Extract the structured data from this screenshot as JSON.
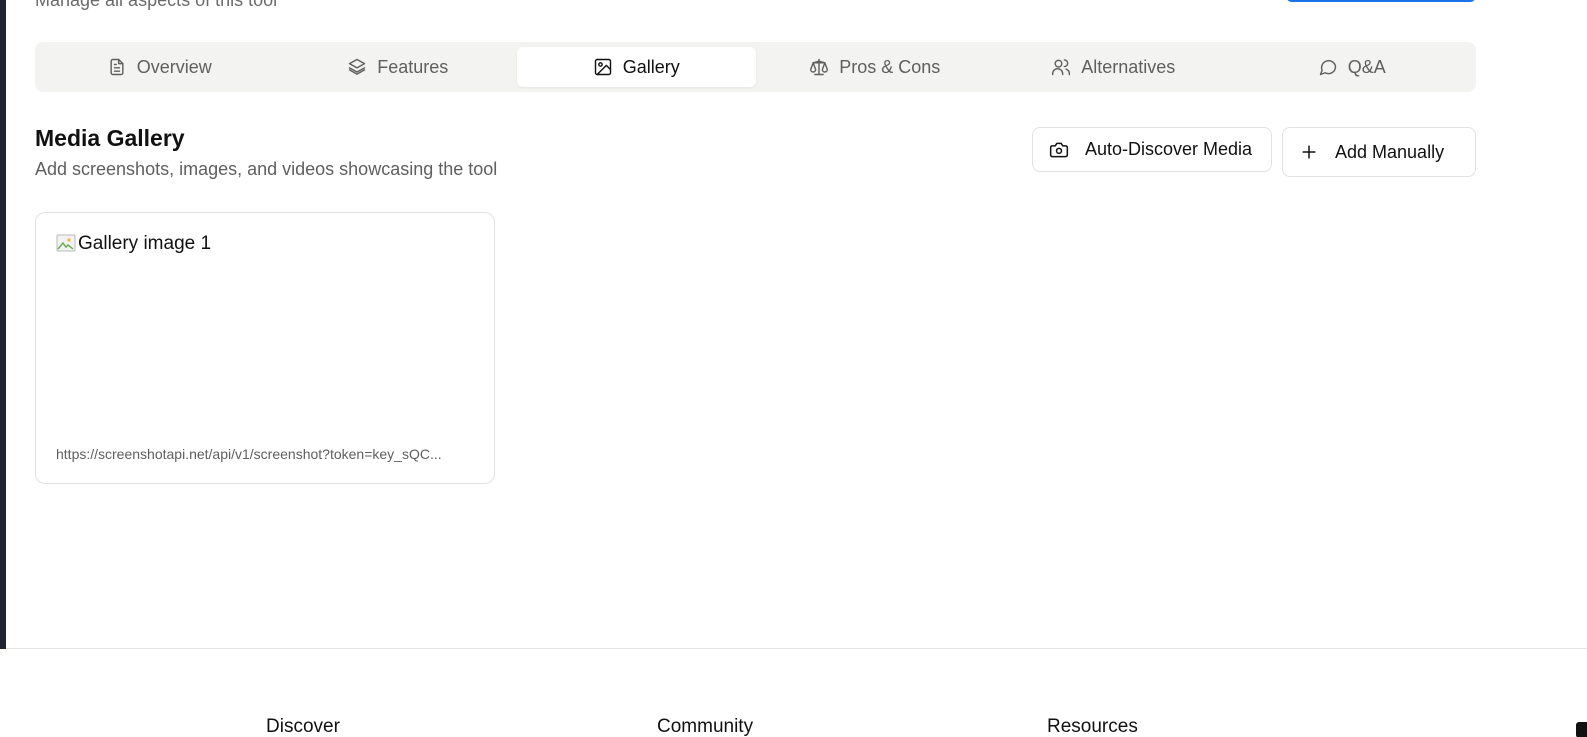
{
  "header": {
    "subtitle": "Manage all aspects of this tool"
  },
  "tabs": [
    {
      "label": "Overview",
      "icon": "document-icon",
      "active": false
    },
    {
      "label": "Features",
      "icon": "layers-icon",
      "active": false
    },
    {
      "label": "Gallery",
      "icon": "image-icon",
      "active": true
    },
    {
      "label": "Pros & Cons",
      "icon": "scale-icon",
      "active": false
    },
    {
      "label": "Alternatives",
      "icon": "users-icon",
      "active": false
    },
    {
      "label": "Q&A",
      "icon": "message-circle-icon",
      "active": false
    }
  ],
  "gallery": {
    "title": "Media Gallery",
    "description": "Add screenshots, images, and videos showcasing the tool",
    "auto_discover_label": "Auto-Discover Media",
    "add_manually_label": "Add Manually",
    "items": [
      {
        "alt": "Gallery image 1",
        "url": "https://screenshotapi.net/api/v1/screenshot?token=key_sQC..."
      }
    ]
  },
  "footer": {
    "headings": [
      "Discover",
      "Community",
      "Resources"
    ]
  },
  "colors": {
    "accent": "#1a73e8",
    "tab_bar_bg": "#f3f3f1",
    "border": "#e2e2e2",
    "muted_text": "#5f5f5f"
  }
}
